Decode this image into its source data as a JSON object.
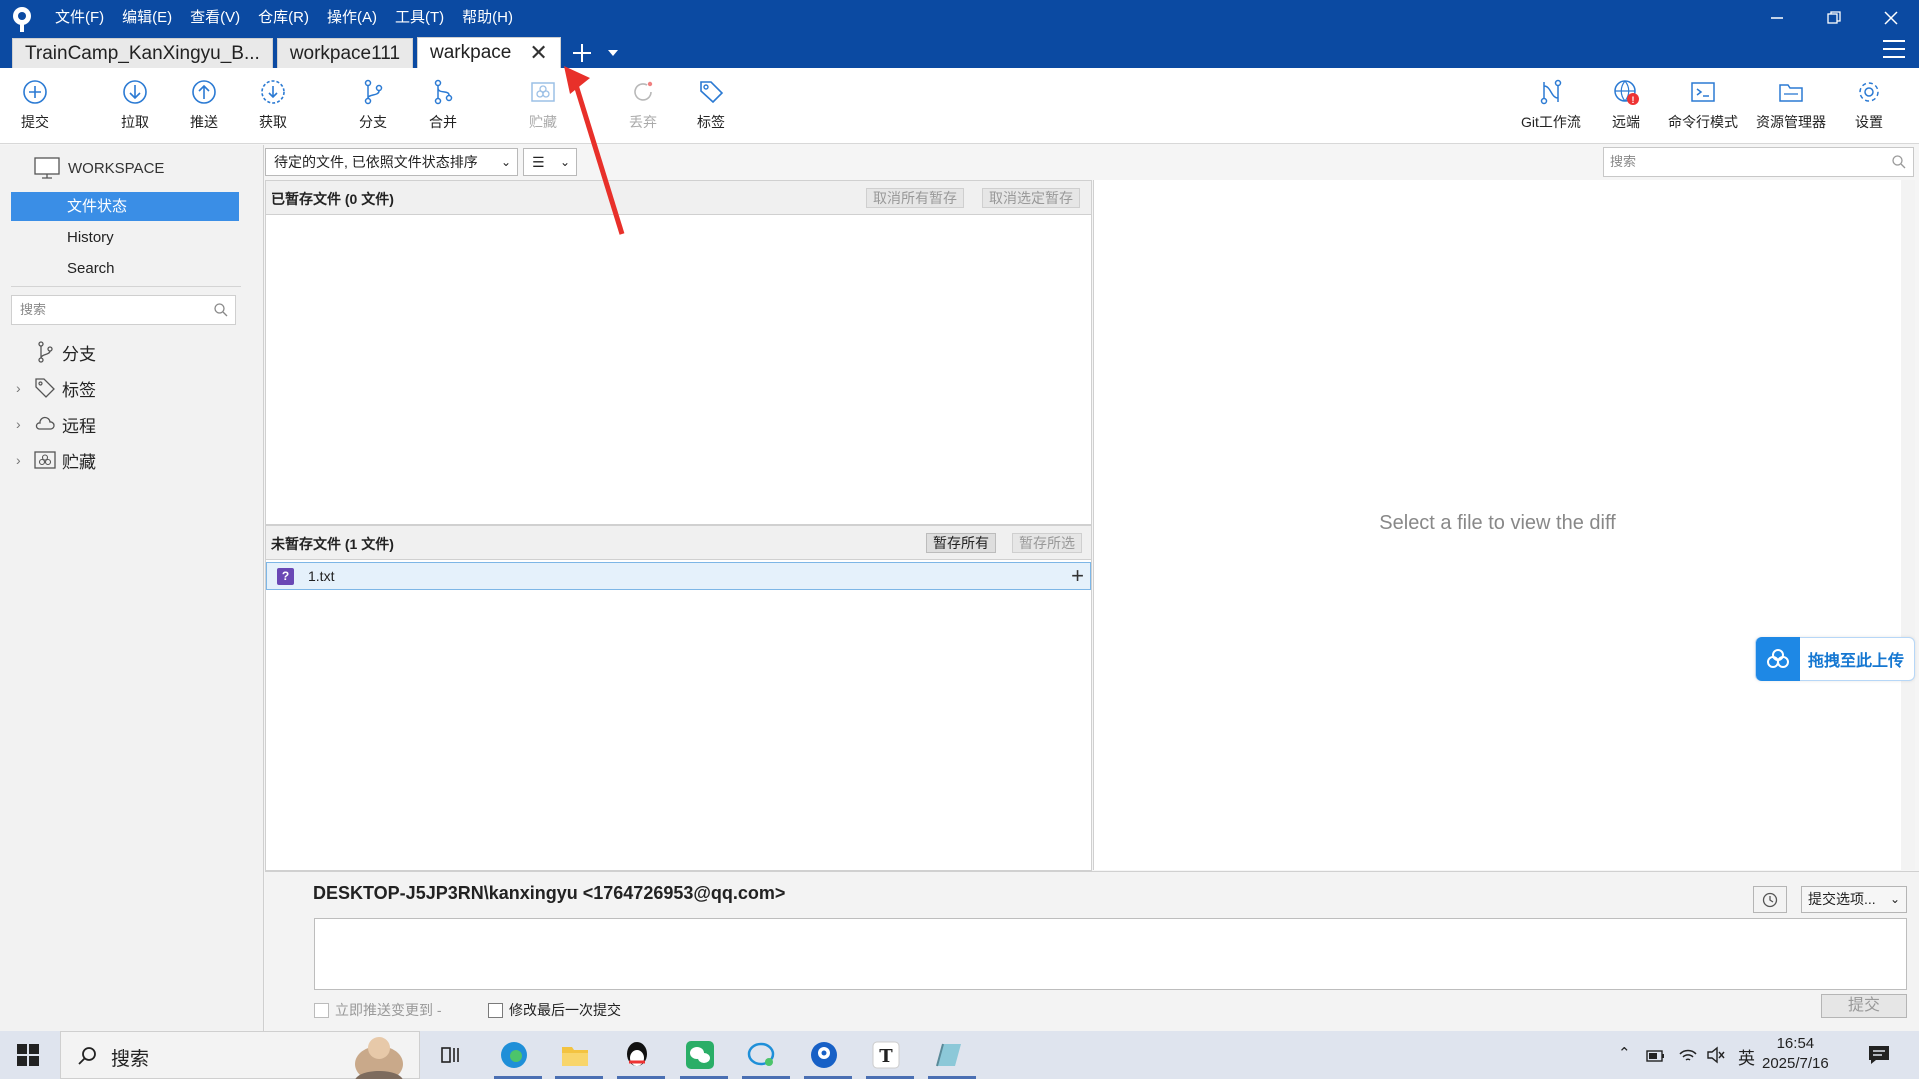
{
  "menu": [
    "文件(F)",
    "编辑(E)",
    "查看(V)",
    "仓库(R)",
    "操作(A)",
    "工具(T)",
    "帮助(H)"
  ],
  "tabs": [
    "TrainCamp_KanXingyu_B...",
    "workpace111",
    "warkpace"
  ],
  "toolbar": {
    "commit": "提交",
    "pull": "拉取",
    "push": "推送",
    "fetch": "获取",
    "branch": "分支",
    "merge": "合并",
    "stash": "贮藏",
    "discard": "丢弃",
    "tag": "标签",
    "gitflow": "Git工作流",
    "remote": "远端",
    "terminal": "命令行模式",
    "explorer": "资源管理器",
    "settings": "设置"
  },
  "sidebar": {
    "workspace": "WORKSPACE",
    "nav": [
      "文件状态",
      "History",
      "Search"
    ],
    "search_placeholder": "搜索",
    "tree": [
      "分支",
      "标签",
      "远程",
      "贮藏"
    ]
  },
  "filter": {
    "sort": "待定的文件, 已依照文件状态排序",
    "view": "☰",
    "search_placeholder": "搜索"
  },
  "staged": {
    "title": "已暂存文件  (0 文件)",
    "unstage_all": "取消所有暂存",
    "unstage_selected": "取消选定暂存"
  },
  "unstaged": {
    "title": "未暂存文件  (1 文件)",
    "stage_all": "暂存所有",
    "stage_selected": "暂存所选",
    "files": [
      {
        "status": "?",
        "name": "1.txt"
      }
    ]
  },
  "diff": {
    "placeholder": "Select a file to view the diff"
  },
  "upload_badge": "拖拽至此上传",
  "commit": {
    "author": "DESKTOP-J5JP3RN\\kanxingyu <1764726953@qq.com>",
    "options": "提交选项...",
    "push_immediately": "立即推送变更到 -",
    "amend": "修改最后一次提交",
    "submit": "提交"
  },
  "taskbar": {
    "search": "搜索",
    "lang": "英",
    "time": "16:54",
    "date": "2025/7/16"
  },
  "colors": {
    "titlebar": "#0b4aa2",
    "selection": "#3a8ee6",
    "arrow": "#e8302a"
  }
}
